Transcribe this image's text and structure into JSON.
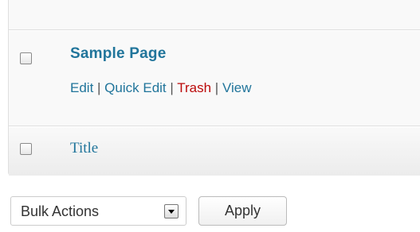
{
  "table": {
    "rows": [
      {
        "title": "Sample Page",
        "row_actions": {
          "edit": "Edit",
          "quick_edit": "Quick Edit",
          "trash": "Trash",
          "view": "View",
          "separator": "|"
        },
        "checked": false
      }
    ],
    "footer": {
      "column_title": "Title",
      "select_all_checked": false
    }
  },
  "bulk": {
    "selected_action": "Bulk Actions",
    "apply_label": "Apply"
  },
  "colors": {
    "link": "#21759b",
    "trash": "#bc0b0b",
    "text": "#333333"
  }
}
